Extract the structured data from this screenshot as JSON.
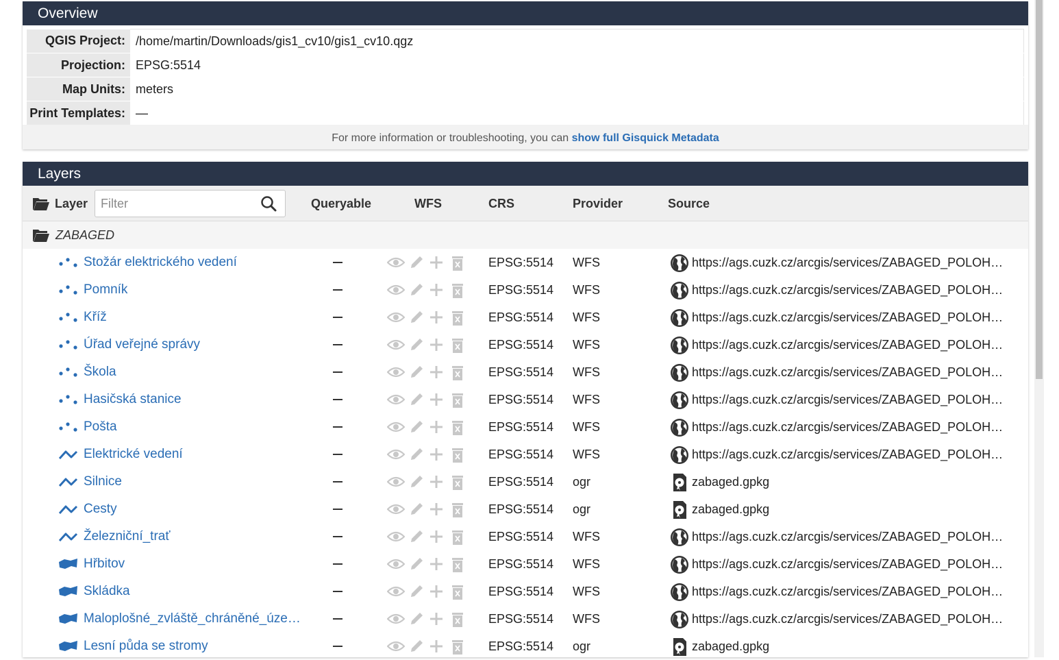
{
  "overview": {
    "title": "Overview",
    "rows": [
      {
        "key": "QGIS Project:",
        "value": "/home/martin/Downloads/gis1_cv10/gis1_cv10.qgz"
      },
      {
        "key": "Projection:",
        "value": "EPSG:5514"
      },
      {
        "key": "Map Units:",
        "value": "meters"
      },
      {
        "key": "Print Templates:",
        "value": "—"
      }
    ],
    "footer_text": "For more information or troubleshooting, you can",
    "footer_link": "show full Gisquick Metadata"
  },
  "layers": {
    "title": "Layers",
    "columns": {
      "layer": "Layer",
      "queryable": "Queryable",
      "wfs": "WFS",
      "crs": "CRS",
      "provider": "Provider",
      "source": "Source"
    },
    "filter_placeholder": "Filter",
    "group": "ZABAGED",
    "items": [
      {
        "name": "Stožár elektrického vedení",
        "geom": "point-icon",
        "queryable": "–",
        "crs": "EPSG:5514",
        "provider": "WFS",
        "source_icon": "globe-icon",
        "source": "https://ags.cuzk.cz/arcgis/services/ZABAGED_POLOH…"
      },
      {
        "name": "Pomník",
        "geom": "point-icon",
        "queryable": "–",
        "crs": "EPSG:5514",
        "provider": "WFS",
        "source_icon": "globe-icon",
        "source": "https://ags.cuzk.cz/arcgis/services/ZABAGED_POLOH…"
      },
      {
        "name": "Kříž",
        "geom": "point-icon",
        "queryable": "–",
        "crs": "EPSG:5514",
        "provider": "WFS",
        "source_icon": "globe-icon",
        "source": "https://ags.cuzk.cz/arcgis/services/ZABAGED_POLOH…"
      },
      {
        "name": "Úřad veřejné správy",
        "geom": "point-icon",
        "queryable": "–",
        "crs": "EPSG:5514",
        "provider": "WFS",
        "source_icon": "globe-icon",
        "source": "https://ags.cuzk.cz/arcgis/services/ZABAGED_POLOH…"
      },
      {
        "name": "Škola",
        "geom": "point-icon",
        "queryable": "–",
        "crs": "EPSG:5514",
        "provider": "WFS",
        "source_icon": "globe-icon",
        "source": "https://ags.cuzk.cz/arcgis/services/ZABAGED_POLOH…"
      },
      {
        "name": "Hasičská stanice",
        "geom": "point-icon",
        "queryable": "–",
        "crs": "EPSG:5514",
        "provider": "WFS",
        "source_icon": "globe-icon",
        "source": "https://ags.cuzk.cz/arcgis/services/ZABAGED_POLOH…"
      },
      {
        "name": "Pošta",
        "geom": "point-icon",
        "queryable": "–",
        "crs": "EPSG:5514",
        "provider": "WFS",
        "source_icon": "globe-icon",
        "source": "https://ags.cuzk.cz/arcgis/services/ZABAGED_POLOH…"
      },
      {
        "name": "Elektrické vedení",
        "geom": "line-icon",
        "queryable": "–",
        "crs": "EPSG:5514",
        "provider": "WFS",
        "source_icon": "globe-icon",
        "source": "https://ags.cuzk.cz/arcgis/services/ZABAGED_POLOH…"
      },
      {
        "name": "Silnice",
        "geom": "line-icon",
        "queryable": "–",
        "crs": "EPSG:5514",
        "provider": "ogr",
        "source_icon": "file-icon",
        "source": "zabaged.gpkg"
      },
      {
        "name": "Cesty",
        "geom": "line-icon",
        "queryable": "–",
        "crs": "EPSG:5514",
        "provider": "ogr",
        "source_icon": "file-icon",
        "source": "zabaged.gpkg"
      },
      {
        "name": "Železniční_trať",
        "geom": "line-icon",
        "queryable": "–",
        "crs": "EPSG:5514",
        "provider": "WFS",
        "source_icon": "globe-icon",
        "source": "https://ags.cuzk.cz/arcgis/services/ZABAGED_POLOH…"
      },
      {
        "name": "Hřbitov",
        "geom": "polygon-icon",
        "queryable": "–",
        "crs": "EPSG:5514",
        "provider": "WFS",
        "source_icon": "globe-icon",
        "source": "https://ags.cuzk.cz/arcgis/services/ZABAGED_POLOH…"
      },
      {
        "name": "Skládka",
        "geom": "polygon-icon",
        "queryable": "–",
        "crs": "EPSG:5514",
        "provider": "WFS",
        "source_icon": "globe-icon",
        "source": "https://ags.cuzk.cz/arcgis/services/ZABAGED_POLOH…"
      },
      {
        "name": "Maloplošné_zvláště_chráněné_úze…",
        "geom": "polygon-icon",
        "queryable": "–",
        "crs": "EPSG:5514",
        "provider": "WFS",
        "source_icon": "globe-icon",
        "source": "https://ags.cuzk.cz/arcgis/services/ZABAGED_POLOH…"
      },
      {
        "name": "Lesní půda se stromy",
        "geom": "polygon-icon",
        "queryable": "–",
        "crs": "EPSG:5514",
        "provider": "ogr",
        "source_icon": "file-icon",
        "source": "zabaged.gpkg"
      }
    ]
  },
  "colors": {
    "header_bg": "#2a3549",
    "link": "#2a6db5",
    "muted_icon": "#c8c8c8"
  }
}
